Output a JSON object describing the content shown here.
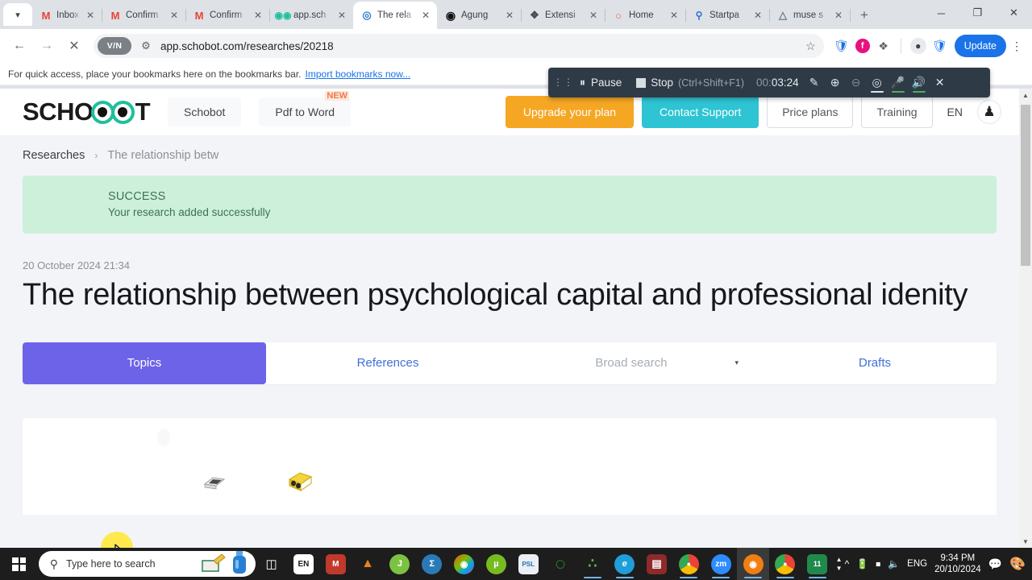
{
  "browser": {
    "tabs": [
      {
        "label": "Inbox (",
        "favicon": "gmail-icon",
        "active": false
      },
      {
        "label": "Confirm",
        "favicon": "gmail-icon",
        "active": false
      },
      {
        "label": "Confirm",
        "favicon": "gmail-icon",
        "active": false
      },
      {
        "label": "app.sch",
        "favicon": "schobot-icon",
        "active": false
      },
      {
        "label": "The rela",
        "favicon": "schobot-target-icon",
        "active": true
      },
      {
        "label": "Agung",
        "favicon": "play-icon",
        "active": false
      },
      {
        "label": "Extensi",
        "favicon": "puzzle-icon",
        "active": false
      },
      {
        "label": "Home",
        "favicon": "ring-icon",
        "active": false
      },
      {
        "label": "Startpa",
        "favicon": "search-blue-icon",
        "active": false
      },
      {
        "label": "muse s",
        "favicon": "muse-icon",
        "active": false
      }
    ],
    "new_tab_label": "+",
    "window_controls": {
      "minimize": "─",
      "maximize": "❐",
      "close": "✕"
    },
    "nav": {
      "back": "←",
      "forward": "→",
      "stop": "✕"
    },
    "omnibox": {
      "vpn_chip": "V/N",
      "site_settings_icon": "tune-icon",
      "url": "app.schobot.com/researches/20218",
      "bookmark_icon": "star-icon"
    },
    "extensions": [
      {
        "name": "lock-shield-extension-icon",
        "glyph": "❉",
        "color": "#1e6fd9"
      },
      {
        "name": "pink-circle-extension-icon",
        "glyph": "f",
        "color": "#e8117f"
      },
      {
        "name": "puzzle-extensions-icon",
        "glyph": "❖",
        "color": "#5f6368"
      },
      {
        "name": "profile-avatar-icon",
        "glyph": "●",
        "color": "#5f6368"
      },
      {
        "name": "blue-check-shield-icon",
        "glyph": "✓",
        "color": "#1a73e8"
      }
    ],
    "update_button": "Update",
    "menu_icon": "kebab-menu-icon",
    "bookmarks_bar": {
      "text": "For quick access, place your bookmarks here on the bookmarks bar.",
      "link": "Import bookmarks now..."
    }
  },
  "recorder": {
    "grip_icon": "drag-grip-icon",
    "pause_label": "Pause",
    "pause_icon": "pause-icon",
    "stop_label": "Stop",
    "stop_shortcut": "(Ctrl+Shift+F1)",
    "stop_icon": "stop-square-icon",
    "time_lead": "00:",
    "time": "03:24",
    "tools": [
      {
        "name": "pencil-annotate-icon",
        "glyph": "✎",
        "state": "normal"
      },
      {
        "name": "zoom-in-icon",
        "glyph": "⊕",
        "state": "normal"
      },
      {
        "name": "zoom-out-icon",
        "glyph": "⊖",
        "state": "dimmed"
      },
      {
        "name": "webcam-icon",
        "glyph": "◎",
        "state": "underline-white"
      },
      {
        "name": "microphone-icon",
        "glyph": "⚇",
        "state": "underline-green"
      },
      {
        "name": "speaker-icon",
        "glyph": "◁",
        "state": "underline-green"
      },
      {
        "name": "close-recorder-icon",
        "glyph": "✕",
        "state": "normal"
      }
    ]
  },
  "site": {
    "logo": {
      "text_before": "SCHO",
      "text_after": "T",
      "eyes_icon": "owl-eyes-icon"
    },
    "nav": [
      {
        "label": "Schobot",
        "badge": ""
      },
      {
        "label": "Pdf to Word",
        "badge": "NEW"
      }
    ],
    "actions": {
      "upgrade": "Upgrade your plan",
      "support": "Contact Support",
      "price": "Price plans",
      "training": "Training",
      "language": "EN",
      "account_icon": "user-avatar-icon"
    }
  },
  "breadcrumb": {
    "root": "Researches",
    "separator": "›",
    "current": "The relationship betw"
  },
  "alert": {
    "title": "SUCCESS",
    "message": "Your research added successfully",
    "color": "#cdf0db"
  },
  "research": {
    "date": "20 October 2024 21:34",
    "title": "The relationship between psychological capital and professional idenity"
  },
  "tabs": [
    {
      "label": "Topics",
      "active": true
    },
    {
      "label": "References",
      "active": false
    },
    {
      "label": "Broad search",
      "active": false,
      "placeholder": true,
      "caret": "▾"
    },
    {
      "label": "Drafts",
      "active": false
    }
  ],
  "cursor": {
    "highlight_color": "#ffe94d"
  },
  "taskbar": {
    "start_icon": "windows-start-icon",
    "search_placeholder": "Type here to search",
    "search_icon": "search-icon",
    "taskview_icon": "task-view-icon",
    "apps": [
      {
        "name": "language-EN-icon",
        "glyph": "EN",
        "color": "#ffffff",
        "fg": "#1a1a1a"
      },
      {
        "name": "mendeley-icon",
        "glyph": "M",
        "color": "#c0392b"
      },
      {
        "name": "vlc-icon",
        "glyph": "▲",
        "color": "#e8821e"
      },
      {
        "name": "spss-icon",
        "glyph": "J",
        "color": "#7cc242"
      },
      {
        "name": "mathtype-icon",
        "glyph": "Σ",
        "color": "#2b7ab8"
      },
      {
        "name": "microsoft-office-icon",
        "glyph": "◑",
        "color": "#d14b7a"
      },
      {
        "name": "utorrent-icon",
        "glyph": "µ",
        "color": "#76bc21"
      },
      {
        "name": "psl-document-icon",
        "glyph": "PSL",
        "color": "#eceff3",
        "fg": "#2b6fb5"
      },
      {
        "name": "green-ring-loading-icon",
        "glyph": "◌",
        "color": "#1d1d1d",
        "fg": "#2ecc40"
      },
      {
        "name": "dots-cluster-icon",
        "glyph": "∴",
        "color": "#1d1d1d",
        "fg": "#6fbf4b"
      },
      {
        "name": "microsoft-edge-icon",
        "glyph": "e",
        "color": "#1f9ed9"
      },
      {
        "name": "winrar-icon",
        "glyph": "▤",
        "color": "#8e2a2a"
      },
      {
        "name": "chrome-icon",
        "glyph": "●",
        "color": "#e74c3c"
      },
      {
        "name": "zoom-icon",
        "glyph": "zm",
        "color": "#2d8cff"
      },
      {
        "name": "avast-icon",
        "glyph": "◉",
        "color": "#f07f13",
        "active": true
      },
      {
        "name": "chrome-profile-icon",
        "glyph": "●",
        "color": "#4285f4"
      },
      {
        "name": "chart-11-icon",
        "glyph": "11",
        "color": "#1f8a4c"
      }
    ],
    "tray": {
      "chevron_icon": "show-hidden-icons-icon",
      "battery_icon": "battery-icon",
      "wifi_icon": "wifi-icon",
      "volume_icon": "volume-icon",
      "language": "ENG",
      "time": "9:34 PM",
      "date": "20/10/2024",
      "notification_icon": "notifications-icon",
      "paint3d_icon": "paint-3d-icon"
    }
  }
}
